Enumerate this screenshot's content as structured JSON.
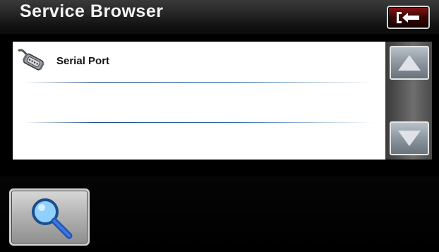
{
  "header": {
    "title": "Service Browser",
    "exit_icon": "exit-arrow-icon"
  },
  "service_list": {
    "items": [
      {
        "label": "Serial Port",
        "icon": "serial-port-icon"
      },
      {
        "label": ""
      },
      {
        "label": ""
      }
    ]
  },
  "scrollbar": {
    "up_icon": "arrow-up-icon",
    "down_icon": "arrow-down-icon"
  },
  "toolbar": {
    "search_icon": "magnifier-icon"
  },
  "colors": {
    "background": "#000000",
    "list_background": "#ffffff",
    "divider": "#2b6aa6",
    "exit_button": "#6a0a0a",
    "button_gray": "#a0a8b0"
  }
}
